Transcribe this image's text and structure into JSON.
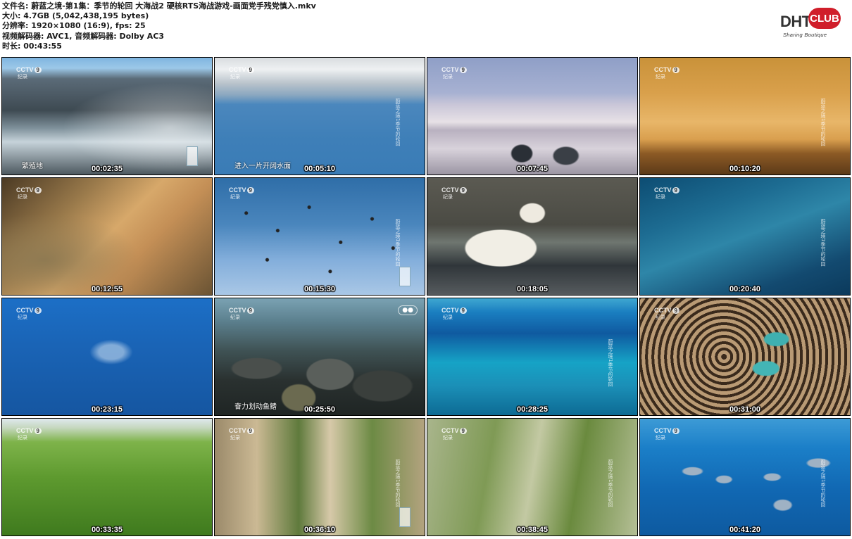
{
  "header": {
    "filename_line": "文件名: 蔚蓝之境-第1集：季节的轮回 大海战2 硬核RTS海战游戏-画面党手残党慎入.mkv",
    "size_line": "大小: 4.7GB (5,042,438,195 bytes)",
    "resolution_line": "分辨率: 1920×1080 (16:9), fps: 25",
    "codec_line": "视频解码器: AVC1, 音频解码器: Dolby AC3",
    "duration_line": "时长: 00:43:55"
  },
  "logo": {
    "left": "DHT",
    "right": "CLUB",
    "tagline": "Sharing Boutique"
  },
  "channel": {
    "name": "CCTV",
    "number": "9",
    "sub": "纪录"
  },
  "vertical_title": "蔚蓝之境1季节的轮回",
  "thumbnails": [
    {
      "time": "00:02:35",
      "caption": "繁殖地"
    },
    {
      "time": "00:05:10",
      "caption": "进入一片开阔水面"
    },
    {
      "time": "00:07:45",
      "caption": ""
    },
    {
      "time": "00:10:20",
      "caption": ""
    },
    {
      "time": "00:12:55",
      "caption": ""
    },
    {
      "time": "00:15:30",
      "caption": ""
    },
    {
      "time": "00:18:05",
      "caption": ""
    },
    {
      "time": "00:20:40",
      "caption": ""
    },
    {
      "time": "00:23:15",
      "caption": ""
    },
    {
      "time": "00:25:50",
      "caption": "奋力划动鱼鳍"
    },
    {
      "time": "00:28:25",
      "caption": ""
    },
    {
      "time": "00:31:00",
      "caption": ""
    },
    {
      "time": "00:33:35",
      "caption": ""
    },
    {
      "time": "00:36:10",
      "caption": ""
    },
    {
      "time": "00:38:45",
      "caption": ""
    },
    {
      "time": "00:41:20",
      "caption": ""
    }
  ],
  "colors": {
    "accent_red": "#d01e2a"
  }
}
